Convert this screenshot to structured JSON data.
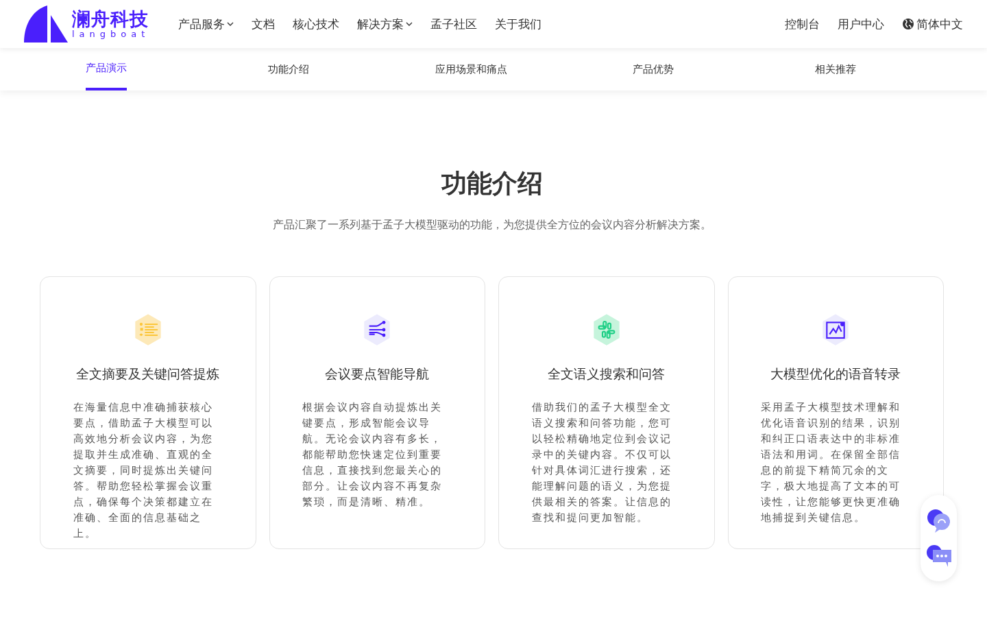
{
  "header": {
    "logo": {
      "name": "澜舟科技",
      "subtitle": "langboat"
    },
    "nav": [
      {
        "label": "产品服务",
        "dropdown": true
      },
      {
        "label": "文档",
        "dropdown": false
      },
      {
        "label": "核心技术",
        "dropdown": false
      },
      {
        "label": "解决方案",
        "dropdown": true
      },
      {
        "label": "孟子社区",
        "dropdown": false
      },
      {
        "label": "关于我们",
        "dropdown": false
      }
    ],
    "right_links": [
      "控制台",
      "用户中心"
    ],
    "language": "简体中文"
  },
  "anchor_tabs": [
    {
      "label": "产品演示",
      "selected": true
    },
    {
      "label": "功能介绍",
      "selected": false
    },
    {
      "label": "应用场景和痛点",
      "selected": false
    },
    {
      "label": "产品优势",
      "selected": false
    },
    {
      "label": "相关推荐",
      "selected": false
    }
  ],
  "section": {
    "title": "功能介绍",
    "subtitle": "产品汇聚了一系列基于孟子大模型驱动的功能，为您提供全方位的会议内容分析解决方案。",
    "cards": [
      {
        "kind": "list",
        "color": "#fde9b8",
        "title": "全文摘要及关键问答提炼",
        "text": "在海量信息中准确捕获核心要点，借助孟子大模型可以高效地分析会议内容，为您提取并生成准确、直观的全文摘要，同时提炼出关键问答。帮助您轻松掌握会议重点，确保每个决策都建立在准确、全面的信息基础之上。"
      },
      {
        "kind": "branches",
        "color": "#ecebfd",
        "title": "会议要点智能导航",
        "text": "根据会议内容自动提炼出关键要点，形成智能会议导航。无论会议内容有多长，都能帮助您快速定位到重要信息，直接找到您最关心的部分。让会议内容不再复杂繁琐，而是清晰、精准。"
      },
      {
        "kind": "bars",
        "color": "#c6f4dc",
        "title": "全文语义搜索和问答",
        "text": "借助我们的孟子大模型全文语义搜索和问答功能，您可以轻松精确地定位到会议记录中的关键内容。不仅可以针对具体词汇进行搜索，还能理解问题的语义，为您提供最相关的答案。让信息的查找和提问更加智能。"
      },
      {
        "kind": "chart",
        "color": "#ecebfd",
        "title": "大模型优化的语音转录",
        "text": "采用孟子大模型技术理解和优化语音识别的结果，识别和纠正口语表达中的非标准语法和用词。在保留全部信息的前提下精简冗余的文字，极大地提高了文本的可读性，让您能够更快更准确地捕捉到关键信息。"
      }
    ]
  }
}
